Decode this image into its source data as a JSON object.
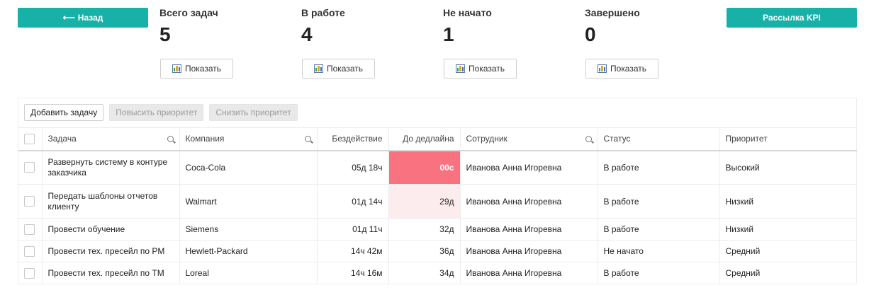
{
  "header": {
    "back_button": {
      "icon": "arrow-left-icon",
      "label": "Назад"
    },
    "kpi_button": {
      "label": "Рассылка KPI"
    }
  },
  "stats": [
    {
      "title": "Всего задач",
      "value": "5",
      "button": "Показать"
    },
    {
      "title": "В работе",
      "value": "4",
      "button": "Показать"
    },
    {
      "title": "Не начато",
      "value": "1",
      "button": "Показать"
    },
    {
      "title": "Завершено",
      "value": "0",
      "button": "Показать"
    }
  ],
  "toolbar": {
    "add_task": "Добавить задачу",
    "raise_priority": "Повысить приоритет",
    "lower_priority": "Снизить приоритет"
  },
  "table": {
    "columns": {
      "task": "Задача",
      "company": "Компания",
      "idle": "Бездействие",
      "deadline": "До дедлайна",
      "employee": "Сотрудник",
      "status": "Статус",
      "priority": "Приоритет"
    },
    "rows": [
      {
        "task": "Развернуть систему в контуре заказчика",
        "company": "Coca-Cola",
        "idle": "05д 18ч",
        "deadline": "00с",
        "employee": "Иванова Анна Игоревна",
        "status": "В работе",
        "priority": "Высокий"
      },
      {
        "task": "Передать шаблоны отчетов клиенту",
        "company": "Walmart",
        "idle": "01д 14ч",
        "deadline": "29д",
        "employee": "Иванова Анна Игоревна",
        "status": "В работе",
        "priority": "Низкий"
      },
      {
        "task": "Провести обучение",
        "company": "Siemens",
        "idle": "01д 11ч",
        "deadline": "32д",
        "employee": "Иванова Анна Игоревна",
        "status": "В работе",
        "priority": "Низкий"
      },
      {
        "task": "Провести тех. пресейл по PM",
        "company": "Hewlett-Packard",
        "idle": "14ч 42м",
        "deadline": "36д",
        "employee": "Иванова Анна Игоревна",
        "status": "Не начато",
        "priority": "Средний"
      },
      {
        "task": "Провести тех. пресейл по TM",
        "company": "Loreal",
        "idle": "14ч 16м",
        "deadline": "34д",
        "employee": "Иванова Анна Игоревна",
        "status": "В работе",
        "priority": "Средний"
      }
    ]
  },
  "colors": {
    "accent": "#17b1a8",
    "deadline_overdue": "#f8737f",
    "deadline_warning": "#fdecee"
  }
}
